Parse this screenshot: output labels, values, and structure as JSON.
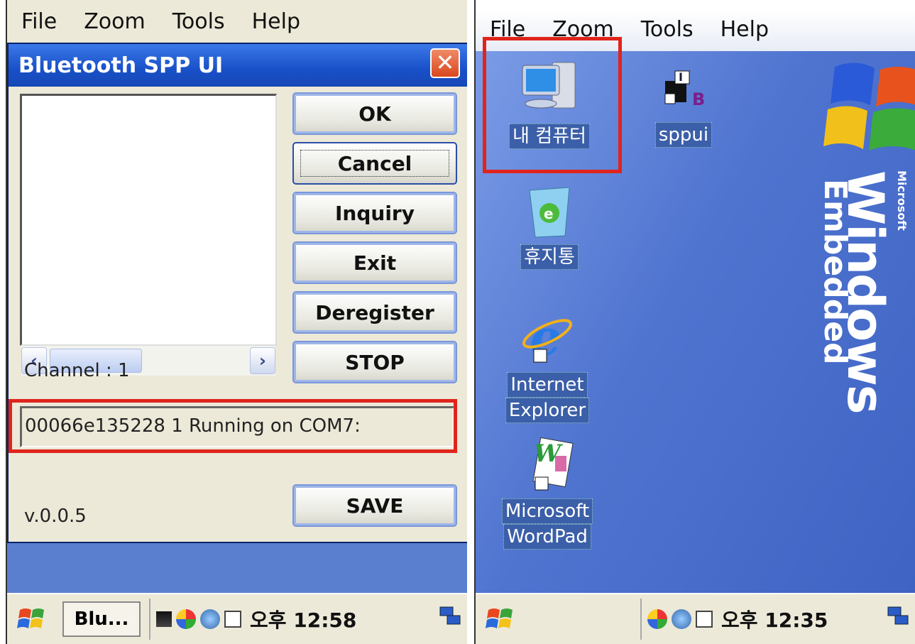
{
  "left": {
    "menu": [
      "File",
      "Zoom",
      "Tools",
      "Help"
    ],
    "dialog": {
      "title": "Bluetooth SPP UI",
      "close_glyph": "✕",
      "buttons": {
        "ok": "OK",
        "cancel": "Cancel",
        "inquiry": "Inquiry",
        "exit": "Exit",
        "deregister": "Deregister",
        "stop": "STOP",
        "save": "SAVE"
      },
      "scroll_left": "‹",
      "scroll_right": "›",
      "channel": "Channel : 1",
      "status": "00066e135228 1 Running on COM7:",
      "version": "v.0.0.5"
    },
    "taskbar": {
      "task_item": "Blu...",
      "clock": "오후 12:58"
    }
  },
  "right": {
    "menu": [
      "File",
      "Zoom",
      "Tools",
      "Help"
    ],
    "desktop_icons": {
      "my_computer": "내 컴퓨터",
      "sppui": "sppui",
      "recycle_bin": "휴지통",
      "ie_line1": "Internet",
      "ie_line2": "Explorer",
      "wordpad_line1": "Microsoft",
      "wordpad_line2": "WordPad"
    },
    "branding": {
      "microsoft": "Microsoft",
      "windows": "Windows",
      "embedded": "Embedded"
    },
    "taskbar": {
      "clock": "오후 12:35"
    }
  },
  "colors": {
    "highlight": "#e0241c",
    "titlebar": "#1950c8",
    "desktop": "#4f74d0"
  }
}
